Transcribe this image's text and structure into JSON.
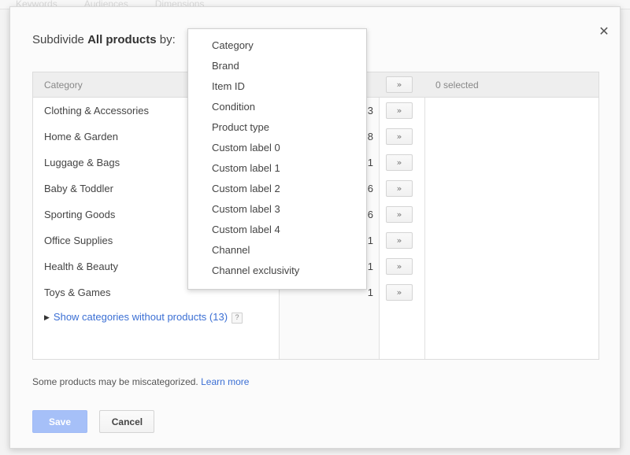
{
  "background": {
    "tabs": [
      "Keywords",
      "Audiences",
      "Dimensions"
    ]
  },
  "dialog": {
    "close_icon": "close-icon",
    "title_prefix": "Subdivide ",
    "title_strong": "All products",
    "title_suffix": " by:",
    "footnote_text": "Some products may be miscategorized.",
    "footnote_link": "Learn more",
    "save_label": "Save",
    "cancel_label": "Cancel",
    "save_color": "#a6c0f8"
  },
  "dropdown": {
    "items": [
      "Category",
      "Brand",
      "Item ID",
      "Condition",
      "Product type",
      "Custom label 0",
      "Custom label 1",
      "Custom label 2",
      "Custom label 3",
      "Custom label 4",
      "Channel",
      "Channel exclusivity"
    ]
  },
  "table": {
    "header_category": "Category",
    "header_count": "",
    "header_selected": "0 selected",
    "add_all_label": "»",
    "add_label": "»",
    "rows": [
      {
        "name": "Clothing & Accessories",
        "count": "3"
      },
      {
        "name": "Home & Garden",
        "count": "8"
      },
      {
        "name": "Luggage & Bags",
        "count": "1"
      },
      {
        "name": "Baby & Toddler",
        "count": "6"
      },
      {
        "name": "Sporting Goods",
        "count": "6"
      },
      {
        "name": "Office Supplies",
        "count": "1"
      },
      {
        "name": "Health & Beauty",
        "count": "1"
      },
      {
        "name": "Toys & Games",
        "count": "1"
      }
    ],
    "show_more_arrow": "▶",
    "show_more_label": "Show categories without products (13)",
    "show_more_help": "?"
  }
}
